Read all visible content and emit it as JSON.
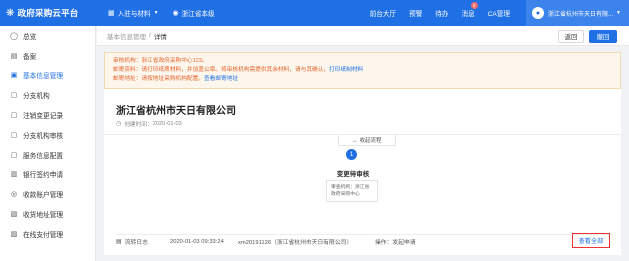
{
  "topbar": {
    "logo": "政府采购云平台",
    "nav_menu": "入驻与材料",
    "region": "浙江省本级",
    "links": {
      "front_hall": "前台大厅",
      "warning": "预警",
      "todo": "待办",
      "message": "消息",
      "ca": "CA管理"
    },
    "message_badge": "3",
    "user_name": "浙江省杭州市天日有限..."
  },
  "sidebar": {
    "items": [
      {
        "label": "总览",
        "icon": "overview-icon"
      },
      {
        "label": "备案",
        "icon": "file-icon"
      },
      {
        "label": "基本信息管理",
        "icon": "info-icon"
      },
      {
        "label": "分支机构",
        "icon": "doc-icon"
      },
      {
        "label": "注销变更记录",
        "icon": "doc-icon"
      },
      {
        "label": "分支机构审核",
        "icon": "doc-icon"
      },
      {
        "label": "服务信息配置",
        "icon": "doc-icon"
      },
      {
        "label": "银行签约申请",
        "icon": "bank-icon"
      },
      {
        "label": "收款账户管理",
        "icon": "wallet-icon"
      },
      {
        "label": "收货地址管理",
        "icon": "location-icon"
      },
      {
        "label": "在线支付管理",
        "icon": "pay-icon"
      }
    ],
    "active_index": 2
  },
  "breadcrumb": {
    "parent": "基本信息管理",
    "separator": "/",
    "current": "详情"
  },
  "actions": {
    "back": "返回",
    "withdraw": "撤回"
  },
  "notice": {
    "line1": "审核机构：浙江省政府采购中心122。",
    "line2_prefix": "邮寄资料：请打印纸质材料，并加盖公章。将审核机构需提供其余材料，请与其确认，",
    "line2_link": "打印纸制材料",
    "line3_prefix": "邮寄地址：请按地址采购机构配置。",
    "line3_link": "查看邮寄地址"
  },
  "company": {
    "name": "浙江省杭州市天日有限公司",
    "created_label": "创建时间：",
    "created_date": "2020-01-03"
  },
  "flow": {
    "collapse_label": "收起流程",
    "step_number": "1",
    "step_title": "变更待审核",
    "review_org_label": "审查机构：浙江省政府采购中心"
  },
  "log": {
    "title": "流转日志",
    "time": "2020-01-03 09:33:24",
    "user": "xm20191126（浙江省杭州市天日有限公司）",
    "operation": "操作：发起申请",
    "view_all": "查看全部"
  },
  "colors": {
    "primary": "#1f6fe5",
    "notice_bg": "#fdf6ec",
    "notice_text": "#e6652e",
    "highlight_border": "#e33"
  }
}
